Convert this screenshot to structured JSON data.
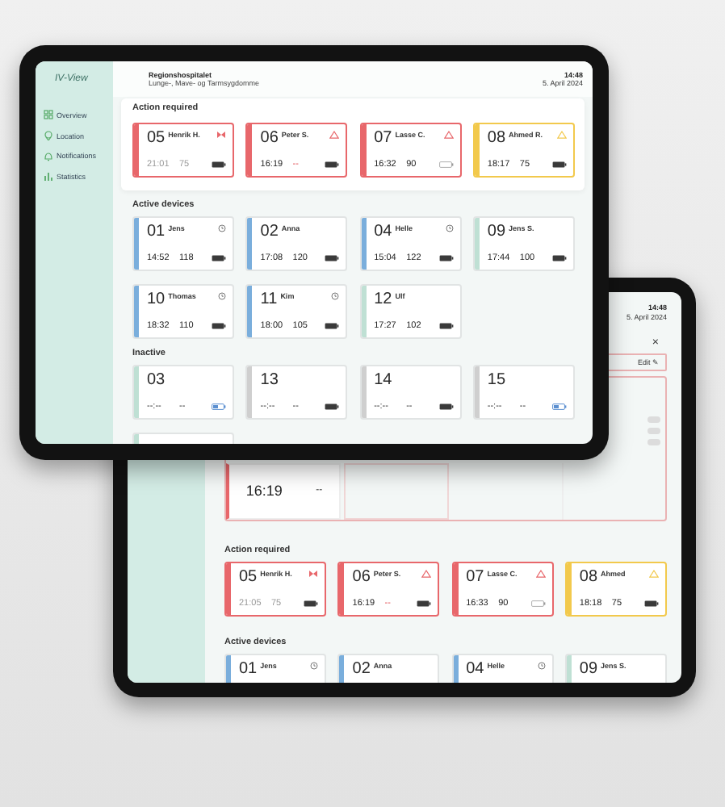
{
  "front": {
    "app_name": "IV-View",
    "nav": [
      {
        "label": "Overview"
      },
      {
        "label": "Location"
      },
      {
        "label": "Notifications"
      },
      {
        "label": "Statistics"
      }
    ],
    "header": {
      "hospital": "Regionshospitalet",
      "department": "Lunge-, Mave- og Tarmsygdomme",
      "time": "14:48",
      "date": "5. April 2024"
    },
    "sections": [
      {
        "title": "Action required",
        "kind": "panel",
        "cards": [
          {
            "number": "05",
            "name": "Henrik H.",
            "kind": "occlusion",
            "color": "#e8676b",
            "dimmed": true,
            "finish": "21:01",
            "rate": "75",
            "rate_alert": false,
            "charging": false,
            "battery_empty": false
          },
          {
            "number": "06",
            "name": "Peter S.",
            "kind": "warning",
            "color": "#e8676b",
            "dimmed": false,
            "finish": "16:19",
            "rate": "--",
            "rate_alert": true,
            "charging": false,
            "battery_empty": false
          },
          {
            "number": "07",
            "name": "Lasse C.",
            "kind": "warning",
            "color": "#e8676b",
            "dimmed": false,
            "finish": "16:32",
            "rate": "90",
            "rate_alert": false,
            "charging": false,
            "battery_empty": true
          },
          {
            "number": "08",
            "name": "Ahmed R.",
            "kind": "warning",
            "color": "#f2c94c",
            "dimmed": false,
            "finish": "18:17",
            "rate": "75",
            "rate_alert": false,
            "charging": false,
            "battery_empty": false
          }
        ]
      },
      {
        "title": "Active devices",
        "kind": "plain",
        "cards": [
          {
            "number": "01",
            "name": "Jens",
            "kind": "timer",
            "color": "#7aaedc",
            "dimmed": false,
            "finish": "14:52",
            "rate": "118",
            "rate_alert": false,
            "charging": false,
            "battery_empty": false
          },
          {
            "number": "02",
            "name": "Anna",
            "kind": "plain",
            "color": "#7aaedc",
            "dimmed": false,
            "finish": "17:08",
            "rate": "120",
            "rate_alert": false,
            "charging": false,
            "battery_empty": false
          },
          {
            "number": "04",
            "name": "Helle",
            "kind": "timer",
            "color": "#7aaedc",
            "dimmed": false,
            "finish": "15:04",
            "rate": "122",
            "rate_alert": false,
            "charging": false,
            "battery_empty": false
          },
          {
            "number": "09",
            "name": "Jens S.",
            "kind": "plain",
            "color": "#bfe0d4",
            "dimmed": false,
            "finish": "17:44",
            "rate": "100",
            "rate_alert": false,
            "charging": false,
            "battery_empty": false
          },
          {
            "number": "10",
            "name": "Thomas",
            "kind": "timer",
            "color": "#7aaedc",
            "dimmed": false,
            "finish": "18:32",
            "rate": "110",
            "rate_alert": false,
            "charging": false,
            "battery_empty": false
          },
          {
            "number": "11",
            "name": "Kim",
            "kind": "timer",
            "color": "#7aaedc",
            "dimmed": false,
            "finish": "18:00",
            "rate": "105",
            "rate_alert": false,
            "charging": false,
            "battery_empty": false
          },
          {
            "number": "12",
            "name": "Ulf",
            "kind": "plain",
            "color": "#bfe0d4",
            "dimmed": false,
            "finish": "17:27",
            "rate": "102",
            "rate_alert": false,
            "charging": false,
            "battery_empty": false
          }
        ]
      },
      {
        "title": "Inactive",
        "kind": "plain",
        "cards": [
          {
            "number": "03",
            "kind": "plain",
            "color": "#bfe0d4",
            "dimmed": false,
            "finish": "--:--",
            "rate": "--",
            "rate_alert": false,
            "charging": true,
            "battery_empty": false
          },
          {
            "number": "13",
            "kind": "plain",
            "color": "#cfcfcf",
            "dimmed": false,
            "finish": "--:--",
            "rate": "--",
            "rate_alert": false,
            "charging": false,
            "battery_empty": false
          },
          {
            "number": "14",
            "kind": "plain",
            "color": "#cfcfcf",
            "dimmed": false,
            "finish": "--:--",
            "rate": "--",
            "rate_alert": false,
            "charging": false,
            "battery_empty": false
          },
          {
            "number": "15",
            "kind": "plain",
            "color": "#cfcfcf",
            "dimmed": false,
            "finish": "--:--",
            "rate": "--",
            "rate_alert": false,
            "charging": true,
            "battery_empty": false
          },
          {
            "kind": "plain",
            "color": "#bfe0d4"
          }
        ]
      }
    ]
  },
  "back": {
    "header": {
      "time": "14:48",
      "date": "5. April 2024"
    },
    "close": "×",
    "edit": "Edit ✎",
    "toggles": [
      {
        "on": false
      },
      {
        "on": false
      },
      {
        "on": false
      }
    ],
    "detail": {
      "finish": "16:19",
      "rate": "--"
    },
    "sections": [
      {
        "title": "Action required",
        "cards": [
          {
            "number": "05",
            "name": "Henrik H.",
            "kind": "occlusion",
            "color": "#e8676b",
            "dimmed": true,
            "finish": "21:05",
            "rate": "75",
            "rate_alert": false,
            "charging": false,
            "battery_empty": false
          },
          {
            "number": "06",
            "name": "Peter S.",
            "kind": "warning",
            "color": "#e8676b",
            "dimmed": false,
            "finish": "16:19",
            "rate": "--",
            "rate_alert": true,
            "charging": false,
            "battery_empty": false
          },
          {
            "number": "07",
            "name": "Lasse C.",
            "kind": "warning",
            "color": "#e8676b",
            "dimmed": false,
            "finish": "16:33",
            "rate": "90",
            "rate_alert": false,
            "charging": false,
            "battery_empty": true
          },
          {
            "number": "08",
            "name": "Ahmed",
            "kind": "warning",
            "color": "#f2c94c",
            "dimmed": false,
            "finish": "18:18",
            "rate": "75",
            "rate_alert": false,
            "charging": false,
            "battery_empty": false
          }
        ]
      },
      {
        "title": "Active devices",
        "cards": [
          {
            "number": "01",
            "name": "Jens",
            "kind": "timer",
            "color": "#7aaedc"
          },
          {
            "number": "02",
            "name": "Anna",
            "kind": "plain",
            "color": "#7aaedc"
          },
          {
            "number": "04",
            "name": "Helle",
            "kind": "timer",
            "color": "#7aaedc"
          },
          {
            "number": "09",
            "name": "Jens S.",
            "kind": "plain",
            "color": "#bfe0d4"
          }
        ]
      }
    ]
  }
}
